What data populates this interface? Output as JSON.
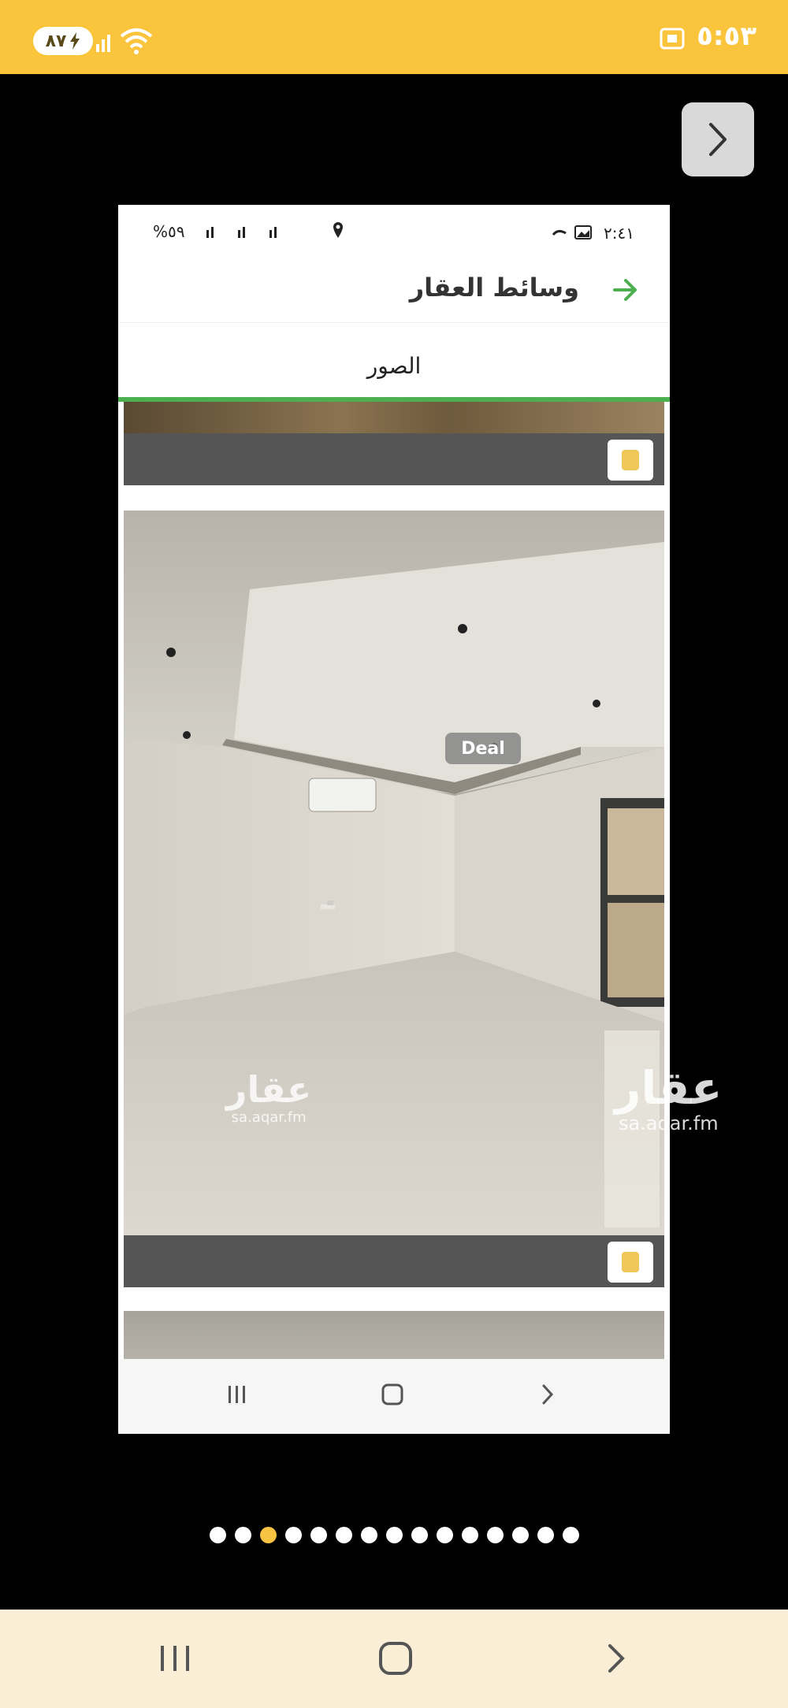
{
  "outer_status": {
    "time": "٥:٥٣",
    "battery_level": "٨٧"
  },
  "inner_status": {
    "time": "٢:٤١",
    "battery": "%٥٩"
  },
  "header": {
    "title": "وسائط العقار"
  },
  "tabs": [
    {
      "label": "الصور",
      "active": true
    }
  ],
  "watermarks": {
    "aqar_text": "عقار",
    "aqar_domain": "sa.aqar.fm",
    "deal_logo": "Deal"
  },
  "pager": {
    "count": 15,
    "active_index": 2
  },
  "colors": {
    "status_bar": "#fbc43d",
    "accent_green": "#4caf50",
    "active_dot": "#f6c342",
    "nav_bar": "#fbeed6"
  },
  "icons": {
    "gallery_next": "chevron-right-icon",
    "back": "arrow-right-icon",
    "nav_recents": "recents-icon",
    "nav_home": "home-icon",
    "nav_back": "chevron-right-icon"
  }
}
